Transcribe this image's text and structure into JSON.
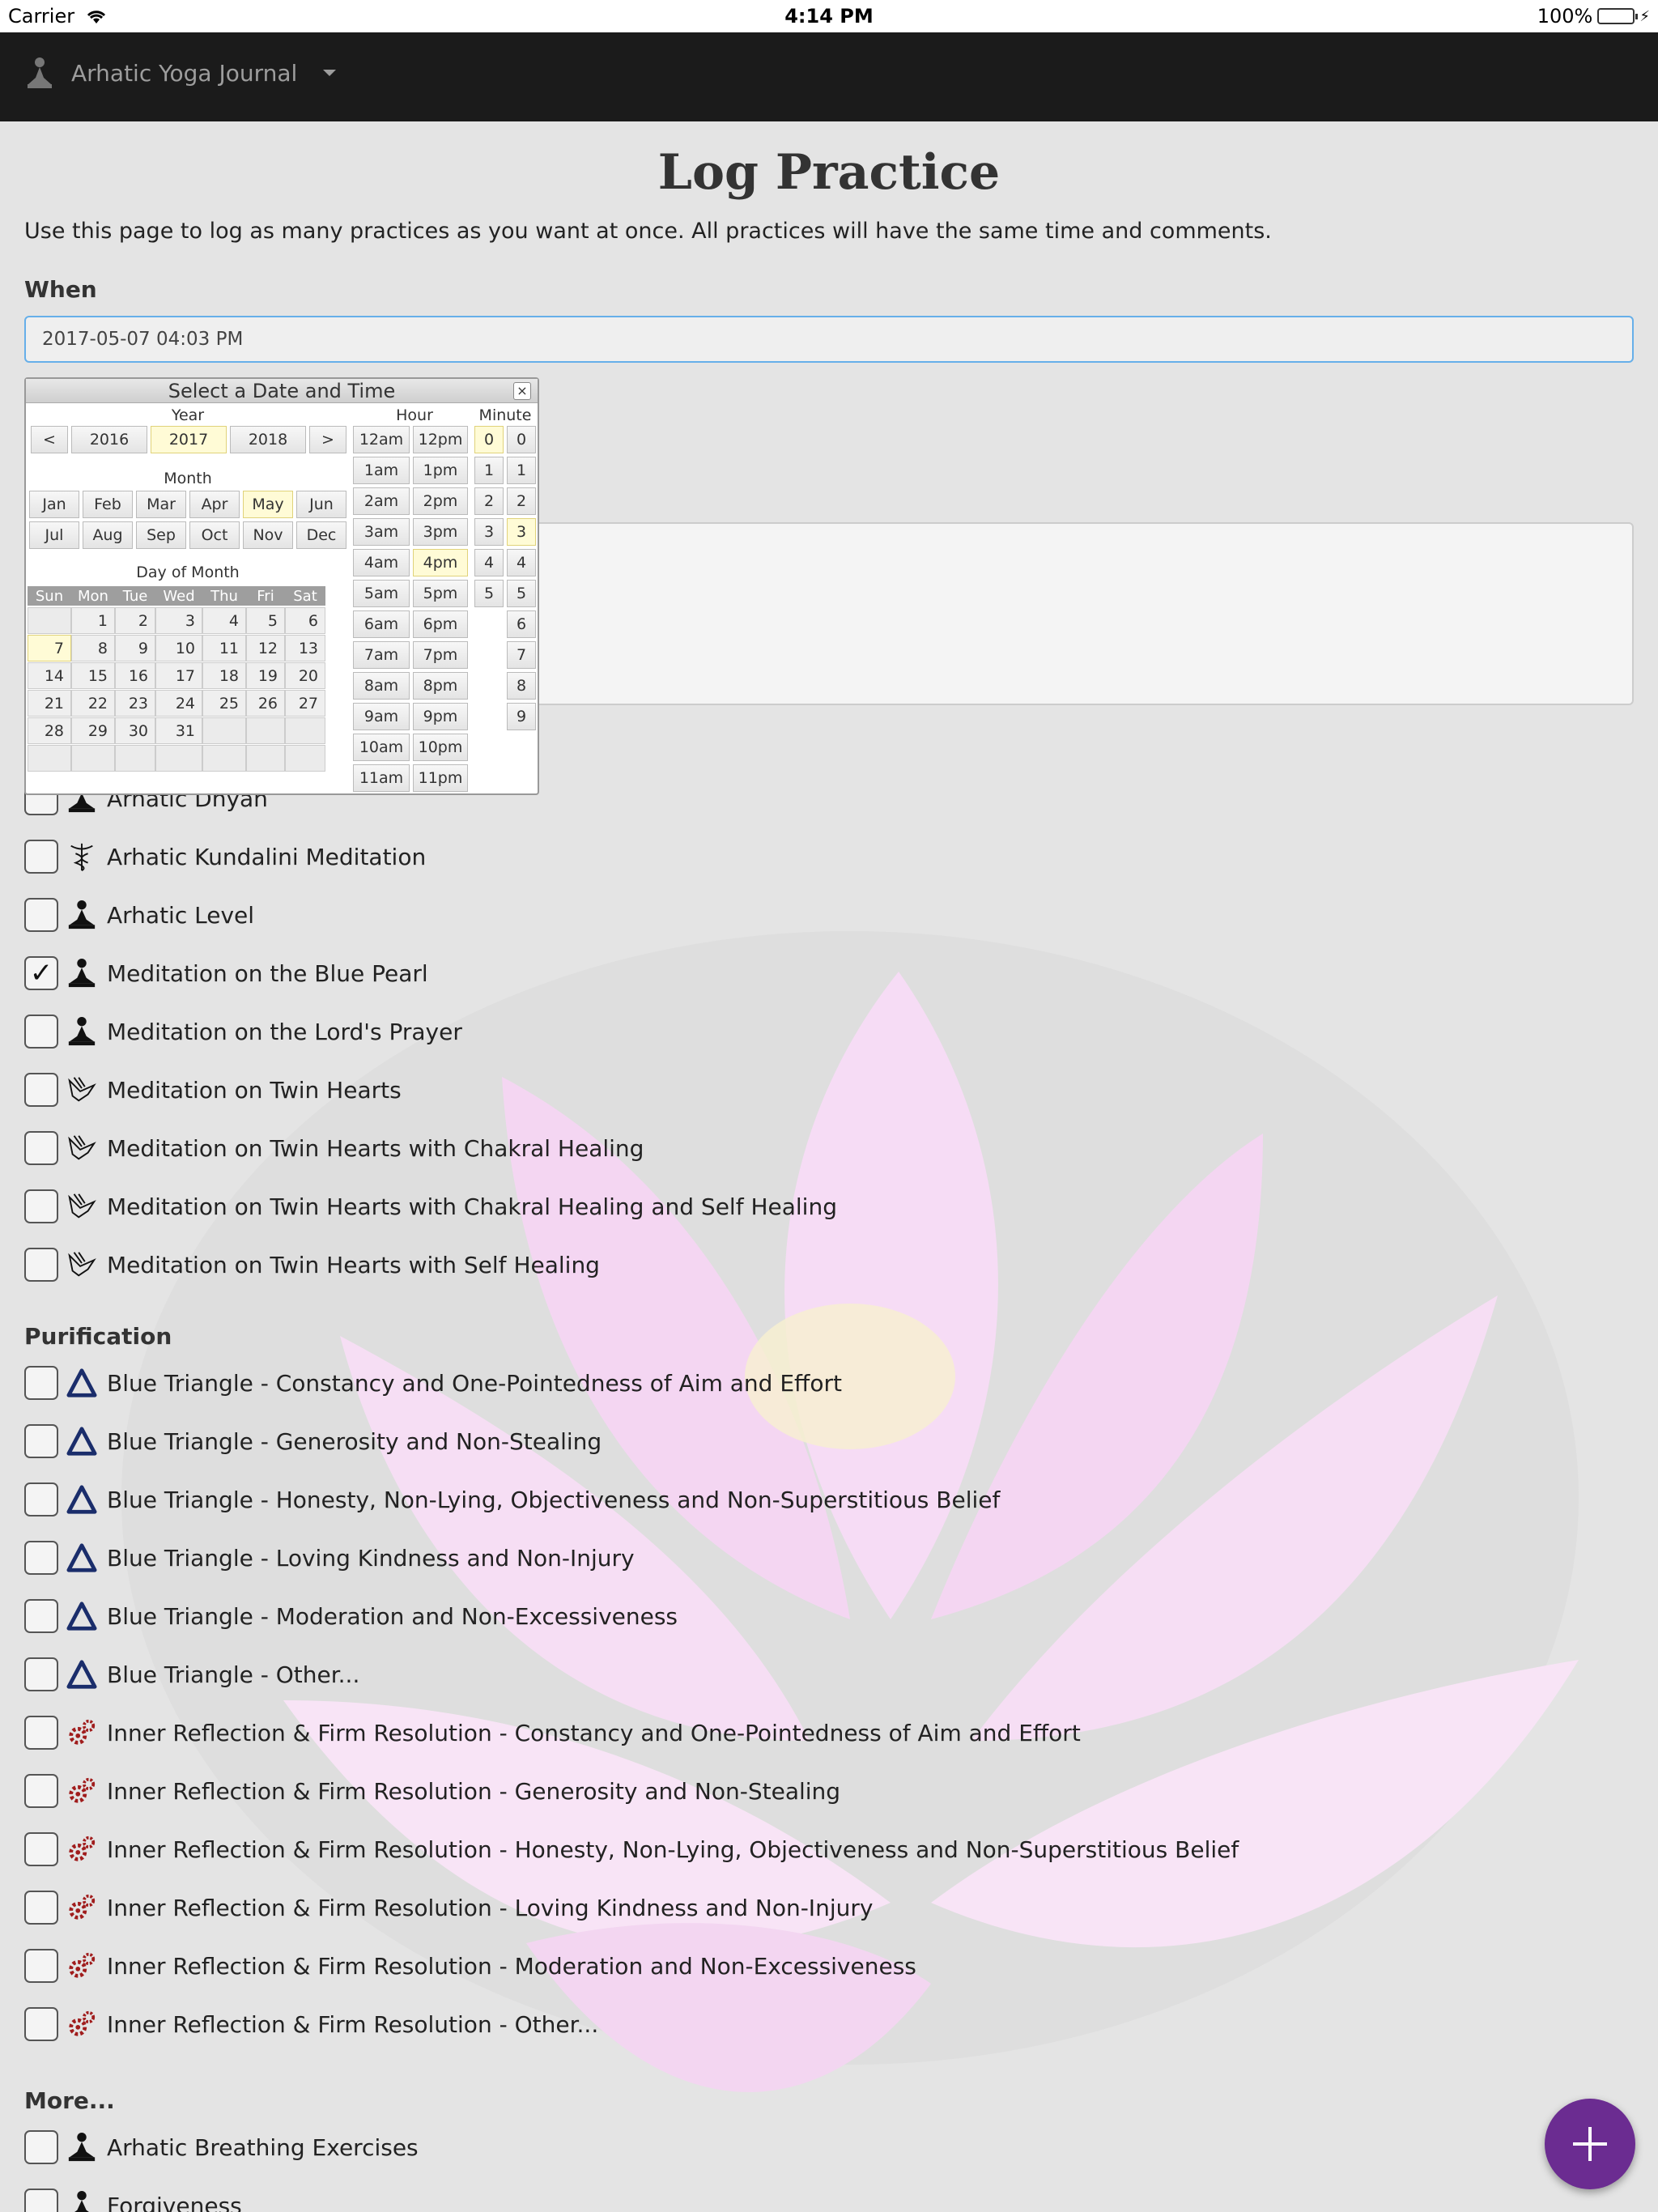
{
  "status_bar": {
    "carrier": "Carrier",
    "time": "4:14 PM",
    "battery": "100%"
  },
  "nav": {
    "brand": "Arhatic Yoga Journal"
  },
  "page": {
    "title": "Log Practice",
    "intro": "Use this page to log as many practices as you want at once. All practices will have the same time and comments.",
    "when_label": "When",
    "when_value": "2017-05-07 04:03 PM"
  },
  "picker": {
    "title": "Select a Date and Time",
    "close": "×",
    "year_caption": "Year",
    "year_prev": "<",
    "year_next": ">",
    "years": [
      "2016",
      "2017",
      "2018"
    ],
    "selected_year": "2017",
    "month_caption": "Month",
    "months": [
      "Jan",
      "Feb",
      "Mar",
      "Apr",
      "May",
      "Jun",
      "Jul",
      "Aug",
      "Sep",
      "Oct",
      "Nov",
      "Dec"
    ],
    "selected_month": "May",
    "dom_caption": "Day of Month",
    "weekdays": [
      "Sun",
      "Mon",
      "Tue",
      "Wed",
      "Thu",
      "Fri",
      "Sat"
    ],
    "days": [
      [
        "",
        "1",
        "2",
        "3",
        "4",
        "5",
        "6"
      ],
      [
        "7",
        "8",
        "9",
        "10",
        "11",
        "12",
        "13"
      ],
      [
        "14",
        "15",
        "16",
        "17",
        "18",
        "19",
        "20"
      ],
      [
        "21",
        "22",
        "23",
        "24",
        "25",
        "26",
        "27"
      ],
      [
        "28",
        "29",
        "30",
        "31",
        "",
        "",
        ""
      ],
      [
        "",
        "",
        "",
        "",
        "",
        "",
        ""
      ]
    ],
    "selected_day": "7",
    "hour_caption": "Hour",
    "hours_am": [
      "12am",
      "1am",
      "2am",
      "3am",
      "4am",
      "5am",
      "6am",
      "7am",
      "8am",
      "9am",
      "10am",
      "11am"
    ],
    "hours_pm": [
      "12pm",
      "1pm",
      "2pm",
      "3pm",
      "4pm",
      "5pm",
      "6pm",
      "7pm",
      "8pm",
      "9pm",
      "10pm",
      "11pm"
    ],
    "selected_hour": "4pm",
    "minute_caption": "Minute",
    "minute_tens": [
      "0",
      "1",
      "2",
      "3",
      "4",
      "5"
    ],
    "minute_ones": [
      "0",
      "1",
      "2",
      "3",
      "4",
      "5",
      "6",
      "7",
      "8",
      "9"
    ],
    "selected_tens": "0",
    "selected_ones": "3"
  },
  "meditation_items": [
    {
      "label": "Arhatic Dhyan",
      "icon": "meditating-figure-icon",
      "checked": false
    },
    {
      "label": "Arhatic Kundalini Meditation",
      "icon": "caduceus-icon",
      "checked": false
    },
    {
      "label": "Arhatic Level",
      "icon": "meditating-figure-icon",
      "checked": false
    },
    {
      "label": "Meditation on the Blue Pearl",
      "icon": "meditating-figure-icon",
      "checked": true
    },
    {
      "label": "Meditation on the Lord's Prayer",
      "icon": "meditating-figure-icon",
      "checked": false
    },
    {
      "label": "Meditation on Twin Hearts",
      "icon": "dove-icon",
      "checked": false
    },
    {
      "label": "Meditation on Twin Hearts with Chakral Healing",
      "icon": "dove-icon",
      "checked": false
    },
    {
      "label": "Meditation on Twin Hearts with Chakral Healing and Self Healing",
      "icon": "dove-icon",
      "checked": false
    },
    {
      "label": "Meditation on Twin Hearts with Self Healing",
      "icon": "dove-icon",
      "checked": false
    }
  ],
  "purification": {
    "heading": "Purification",
    "items": [
      {
        "label": "Blue Triangle - Constancy and One-Pointedness of Aim and Effort",
        "icon": "blue-triangle-icon"
      },
      {
        "label": "Blue Triangle - Generosity and Non-Stealing",
        "icon": "blue-triangle-icon"
      },
      {
        "label": "Blue Triangle - Honesty, Non-Lying, Objectiveness and Non-Superstitious Belief",
        "icon": "blue-triangle-icon"
      },
      {
        "label": "Blue Triangle - Loving Kindness and Non-Injury",
        "icon": "blue-triangle-icon"
      },
      {
        "label": "Blue Triangle - Moderation and Non-Excessiveness",
        "icon": "blue-triangle-icon"
      },
      {
        "label": "Blue Triangle - Other...",
        "icon": "blue-triangle-icon"
      },
      {
        "label": "Inner Reflection & Firm Resolution - Constancy and One-Pointedness of Aim and Effort",
        "icon": "gears-icon"
      },
      {
        "label": "Inner Reflection & Firm Resolution - Generosity and Non-Stealing",
        "icon": "gears-icon"
      },
      {
        "label": "Inner Reflection & Firm Resolution - Honesty, Non-Lying, Objectiveness and Non-Superstitious Belief",
        "icon": "gears-icon"
      },
      {
        "label": "Inner Reflection & Firm Resolution - Loving Kindness and Non-Injury",
        "icon": "gears-icon"
      },
      {
        "label": "Inner Reflection & Firm Resolution - Moderation and Non-Excessiveness",
        "icon": "gears-icon"
      },
      {
        "label": "Inner Reflection & Firm Resolution - Other...",
        "icon": "gears-icon"
      }
    ]
  },
  "more": {
    "heading": "More...",
    "items": [
      {
        "label": "Arhatic Breathing Exercises",
        "icon": "meditating-figure-icon"
      },
      {
        "label": "Forgiveness",
        "icon": "meditating-figure-icon"
      }
    ]
  },
  "fab": {
    "icon": "plus-icon"
  },
  "colors": {
    "navbar": "#1b1b1b",
    "fab": "#6b2c91",
    "triangle": "#1a2d6b",
    "gears": "#a01c1c",
    "focus": "#66afe9"
  }
}
